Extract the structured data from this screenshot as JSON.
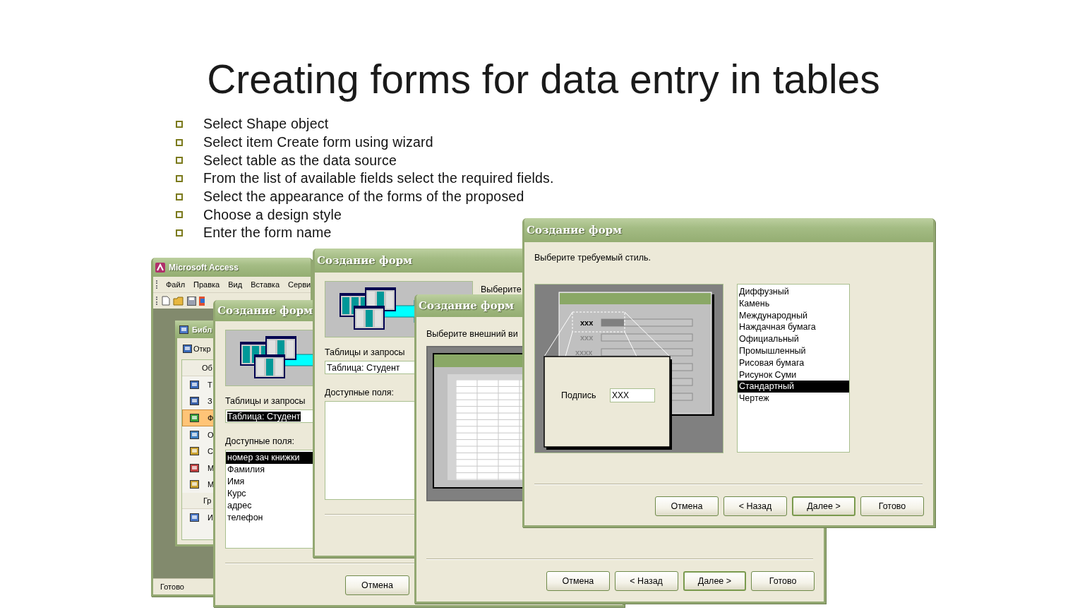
{
  "slide": {
    "title": "Creating forms for data entry in tables",
    "bullets": [
      "Select Shape object",
      "Select item Create form using wizard",
      "Select table as the data source",
      "From the list of available fields select the required fields.",
      "Select the appearance of the forms of the proposed",
      "Choose a design style",
      "Enter the form name"
    ]
  },
  "windows": [
    {
      "kind": "access",
      "title": "Microsoft Access",
      "menu": [
        "Файл",
        "Правка",
        "Вид",
        "Вставка",
        "Серви"
      ],
      "database": {
        "title": "Библ",
        "open": "Откр",
        "groups": [
          {
            "header": "Об",
            "items": [
              {
                "label": "Т",
                "selected": false
              },
              {
                "label": "З",
                "selected": false
              },
              {
                "label": "Ф",
                "selected": true
              },
              {
                "label": "О",
                "selected": false
              },
              {
                "label": "С",
                "selected": false
              },
              {
                "label": "М",
                "selected": false
              },
              {
                "label": "М",
                "selected": false
              }
            ]
          },
          {
            "header": "Гр",
            "items": [
              {
                "label": "И",
                "selected": false
              }
            ]
          }
        ]
      },
      "status": "Готово"
    },
    {
      "kind": "fields",
      "title": "Создание форм",
      "source_label": "Таблицы и запросы",
      "source": {
        "value": "Таблица: Студент",
        "selected": true
      },
      "fields_label": "Доступные поля:",
      "fields": [
        {
          "label": "номер зач книжки",
          "selected": true
        },
        {
          "label": "Фамилия",
          "selected": false
        },
        {
          "label": "Имя",
          "selected": false
        },
        {
          "label": "Курс",
          "selected": false
        },
        {
          "label": "адрес",
          "selected": false
        },
        {
          "label": "телефон",
          "selected": false
        }
      ],
      "buttons": [
        {
          "label": "Отмена",
          "default": false
        }
      ]
    },
    {
      "kind": "fields",
      "title": "Создание форм",
      "prompt": "Выберите",
      "source_label": "Таблицы и запросы",
      "source": {
        "value": "Таблица: Студент",
        "selected": false
      },
      "fields_label": "Доступные поля:"
    },
    {
      "kind": "layout",
      "title": "Создание форм",
      "prompt": "Выберите внешний ви",
      "buttons": [
        {
          "label": "Отмена",
          "default": false
        },
        {
          "label": "< Назад",
          "default": false
        },
        {
          "label": "Далее >",
          "default": true
        },
        {
          "label": "Готово",
          "default": false
        }
      ]
    },
    {
      "kind": "style",
      "title": "Создание форм",
      "prompt": "Выберите требуемый стиль.",
      "preview": {
        "samples": [
          {
            "text": "xxx",
            "selected": true
          },
          {
            "text": "xxx",
            "selected": false
          },
          {
            "text": "xxxx",
            "selected": false
          }
        ],
        "label": "Подпись",
        "value": "XXX"
      },
      "styles": [
        {
          "label": "Диффузный",
          "selected": false
        },
        {
          "label": "Камень",
          "selected": false
        },
        {
          "label": "Международный",
          "selected": false
        },
        {
          "label": "Наждачная бумага",
          "selected": false
        },
        {
          "label": "Официальный",
          "selected": false
        },
        {
          "label": "Промышленный",
          "selected": false
        },
        {
          "label": "Рисовая бумага",
          "selected": false
        },
        {
          "label": "Рисунок Суми",
          "selected": false
        },
        {
          "label": "Стандартный",
          "selected": true
        },
        {
          "label": "Чертеж",
          "selected": false
        }
      ],
      "buttons": [
        {
          "label": "Отмена",
          "default": false
        },
        {
          "label": "< Назад",
          "default": false
        },
        {
          "label": "Далее >",
          "default": true
        },
        {
          "label": "Готово",
          "default": false
        }
      ]
    }
  ]
}
